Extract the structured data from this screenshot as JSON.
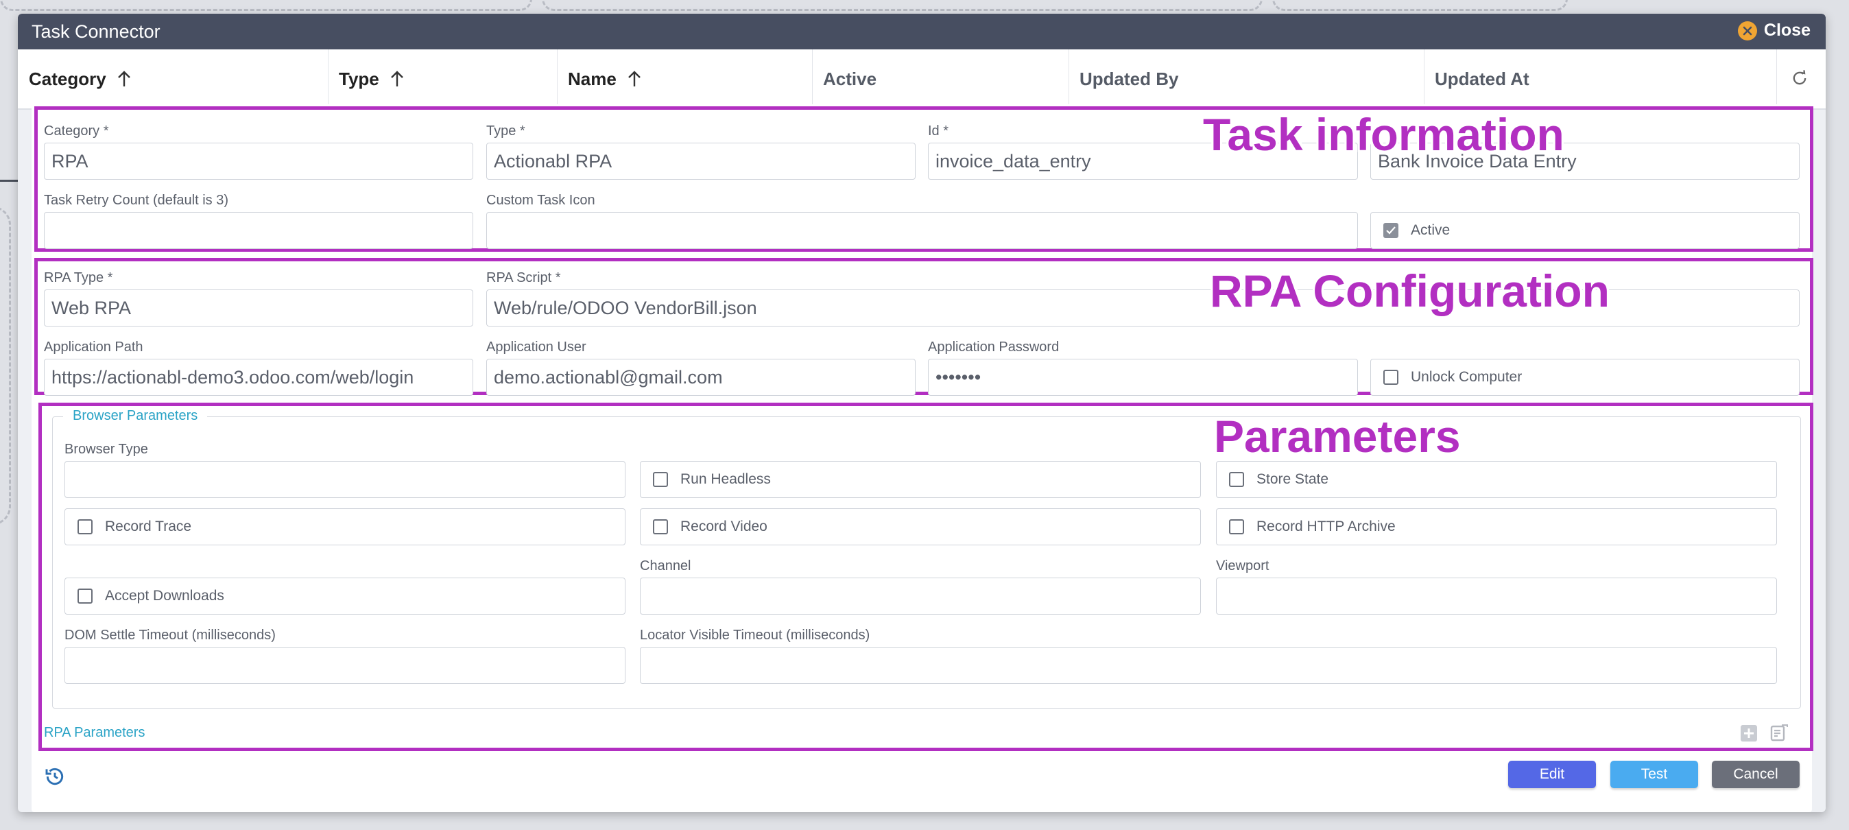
{
  "window": {
    "title": "Task Connector",
    "close_label": "Close"
  },
  "columns": {
    "category": "Category",
    "type": "Type",
    "name": "Name",
    "active": "Active",
    "updated_by": "Updated By",
    "updated_at": "Updated At"
  },
  "annotations": {
    "task_information": "Task information",
    "rpa_configuration": "RPA Configuration",
    "parameters": "Parameters"
  },
  "task_info": {
    "category_label": "Category *",
    "category_value": "RPA",
    "type_label": "Type *",
    "type_value": "Actionabl RPA",
    "id_label": "Id *",
    "id_value": "invoice_data_entry",
    "name_value": "Bank Invoice Data Entry",
    "retry_label": "Task Retry Count (default is 3)",
    "retry_value": "",
    "icon_label": "Custom Task Icon",
    "icon_value": "",
    "active_label": "Active",
    "active_checked": true
  },
  "rpa_config": {
    "rpa_type_label": "RPA Type *",
    "rpa_type_value": "Web RPA",
    "script_label": "RPA Script *",
    "script_value": "Web/rule/ODOO VendorBill.json",
    "app_path_label": "Application Path",
    "app_path_value": "https://actionabl-demo3.odoo.com/web/login",
    "app_user_label": "Application User",
    "app_user_value": "demo.actionabl@gmail.com",
    "app_password_label": "Application Password",
    "app_password_value": "•••••••",
    "unlock_label": "Unlock Computer",
    "unlock_checked": false
  },
  "browser": {
    "legend": "Browser Parameters",
    "browser_type_label": "Browser Type",
    "browser_type_value": "",
    "run_headless": "Run Headless",
    "store_state": "Store State",
    "record_trace": "Record Trace",
    "record_video": "Record Video",
    "record_http": "Record HTTP Archive",
    "accept_downloads": "Accept Downloads",
    "channel_label": "Channel",
    "channel_value": "",
    "viewport_label": "Viewport",
    "viewport_value": "",
    "dom_settle_label": "DOM Settle Timeout (milliseconds)",
    "dom_settle_value": "",
    "locator_label": "Locator Visible Timeout (milliseconds)",
    "locator_value": ""
  },
  "rpa_parameters_link": "RPA Parameters",
  "footer": {
    "edit": "Edit",
    "test": "Test",
    "cancel": "Cancel"
  },
  "colors": {
    "titlebar": "#474e61",
    "annotation": "#b22fc1",
    "link": "#2aa3c6",
    "edit": "#5468e6",
    "test": "#4aabf0",
    "cancel": "#6b6f7a",
    "close_icon": "#f0a533"
  }
}
